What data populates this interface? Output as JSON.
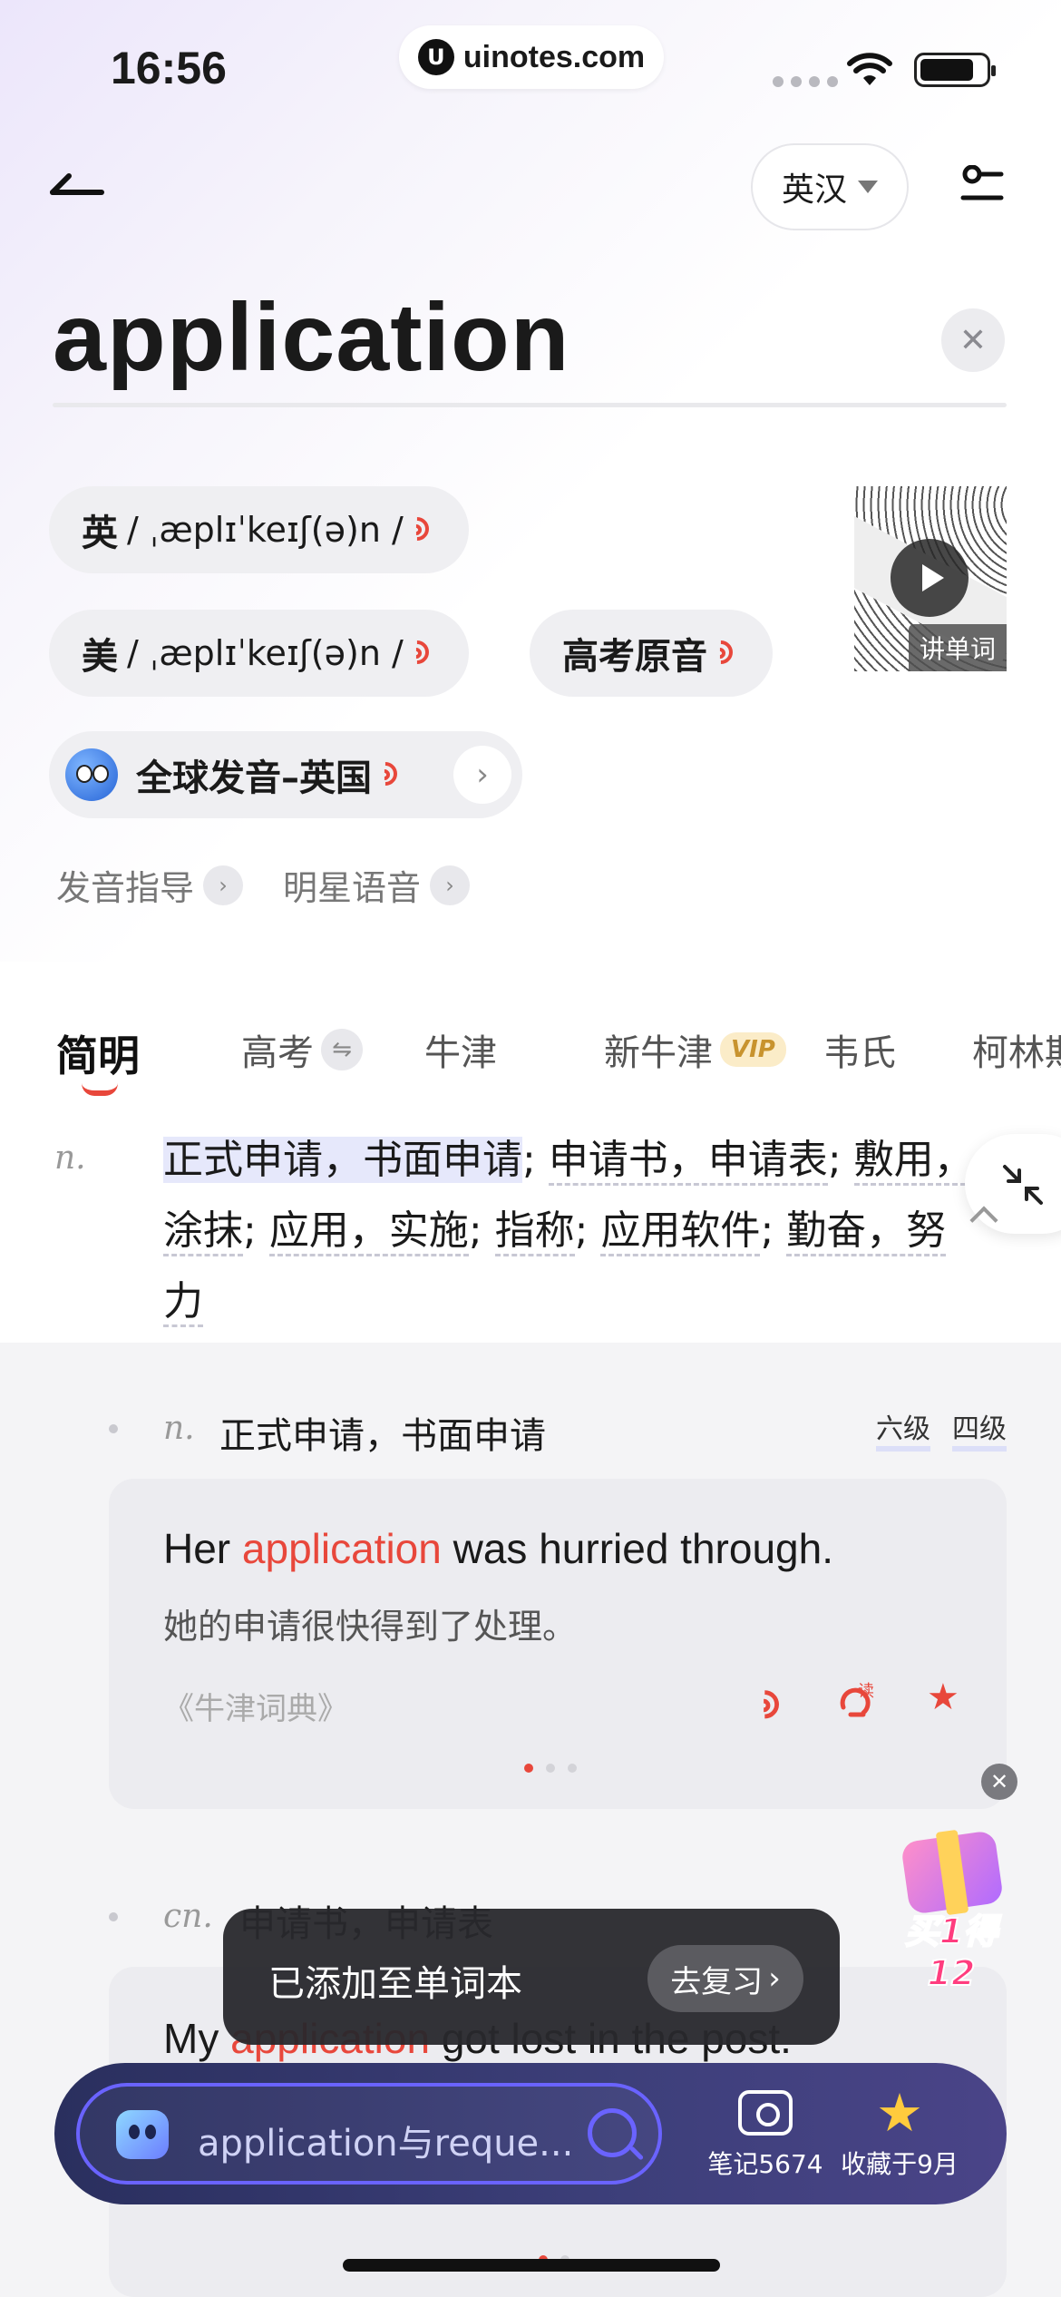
{
  "status_bar": {
    "time": "16:56",
    "url": "uinotes.com",
    "url_logo": "U"
  },
  "header": {
    "back_icon": "back-arrow-icon",
    "lang_label": "英汉",
    "filter_icon": "settings-sliders-icon"
  },
  "word": "application",
  "pronunciation": {
    "uk_flag": "英",
    "uk_ipa": "/ ˌæplɪˈkeɪʃ(ə)n /",
    "us_flag": "美",
    "us_ipa": "/ ˌæplɪˈkeɪʃ(ə)n /",
    "gaokao_audio": "高考原音",
    "global_label": "全球发音–英国",
    "video_label": "讲单词"
  },
  "guides": {
    "pronounce_guide": "发音指导",
    "celebrity_voice": "明星语音"
  },
  "tabs": [
    {
      "label": "简明"
    },
    {
      "label": "高考"
    },
    {
      "label": "牛津"
    },
    {
      "label": "新牛津",
      "badge": "VIP"
    },
    {
      "label": "韦氏"
    },
    {
      "label": "柯林斯"
    }
  ],
  "definition": {
    "pos": "n.",
    "parts": [
      "正式申请，书面申请",
      "; ",
      "申请书，申请表",
      "; ",
      "敷用，涂抹",
      "; ",
      "应用，实施",
      "; ",
      "指称",
      "; ",
      "应用软件",
      "; ",
      "勤奋，努力"
    ]
  },
  "senses": [
    {
      "pos": "n.",
      "meaning": "正式申请，书面申请",
      "levels": [
        "六级",
        "四级"
      ],
      "example_pre": "Her ",
      "example_kw": "application",
      "example_post": " was hurried through.",
      "example_zh": "她的申请很快得到了处理。",
      "source": "《牛津词典》"
    },
    {
      "pos": "cn.",
      "meaning": "申请书，申请表",
      "example_pre": "My ",
      "example_kw": "application",
      "example_post": " got lost in the post."
    }
  ],
  "promo": {
    "text": "买1得12"
  },
  "toast": {
    "message": "已添加至单词本",
    "action": "去复习"
  },
  "bottom_bar": {
    "search_placeholder": "application与reque...",
    "notes_label": "笔记5674",
    "favorites_label": "收藏于9月"
  },
  "colors": {
    "accent": "#e8473b",
    "highlight": "#e6e8fb",
    "bar_bg": "#2a2f5e",
    "bar_border": "#6a63ff"
  }
}
